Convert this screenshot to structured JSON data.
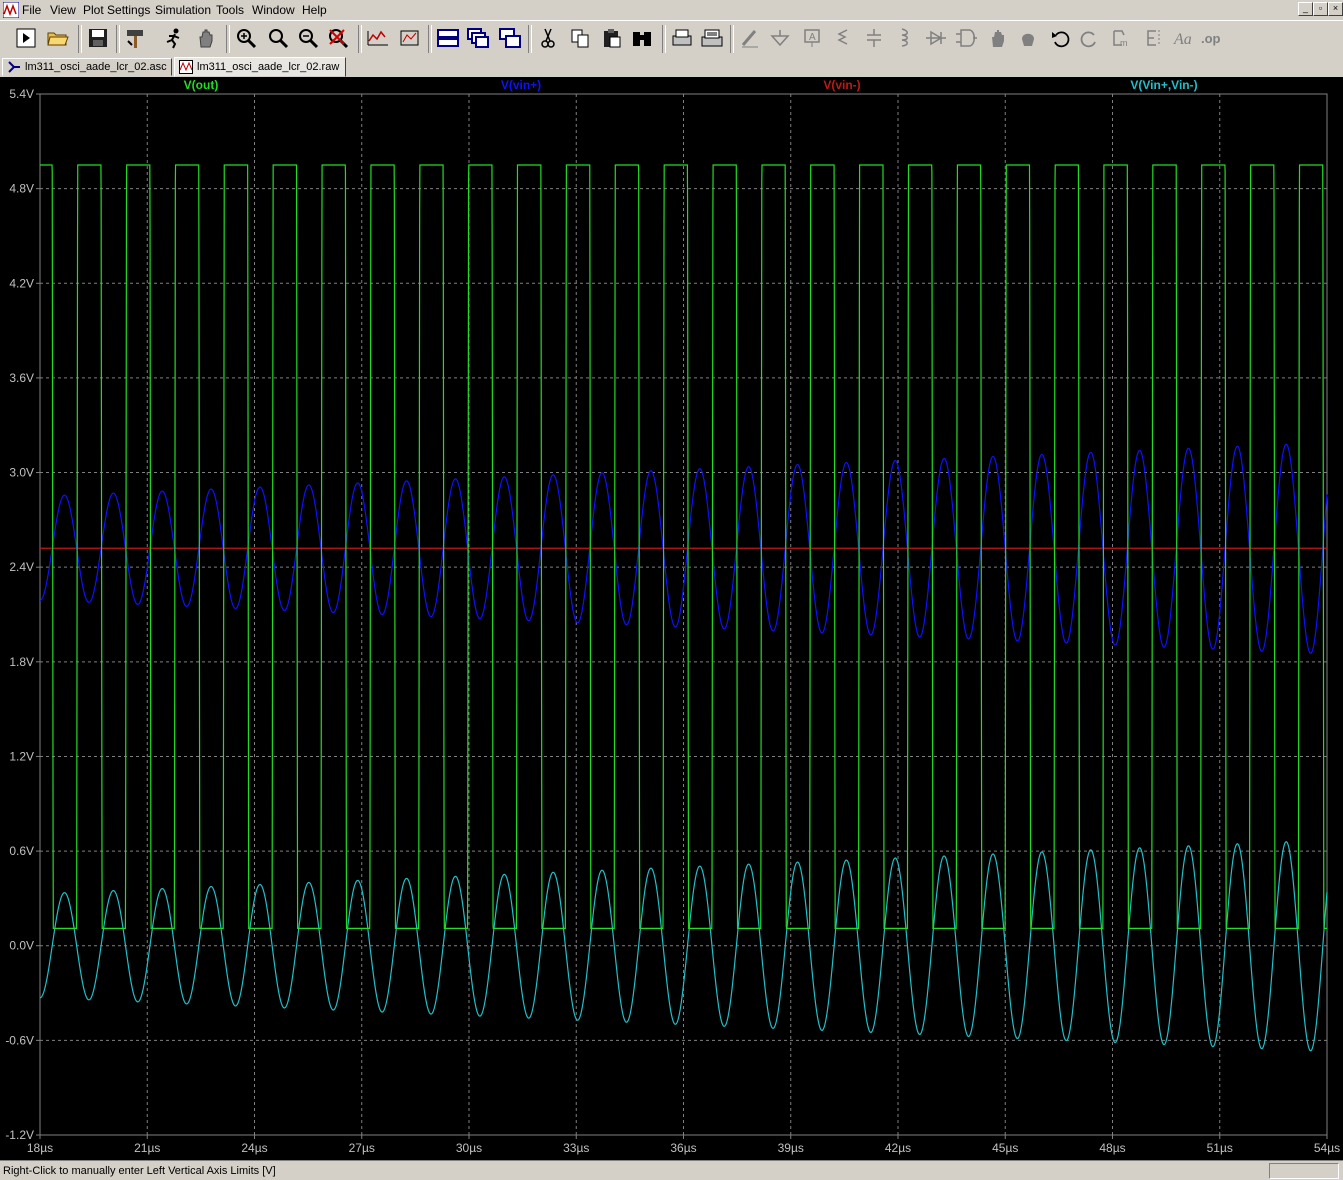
{
  "menu": [
    "File",
    "View",
    "Plot Settings",
    "Simulation",
    "Tools",
    "Window",
    "Help"
  ],
  "tabs": [
    {
      "label": "lm311_osci_aade_lcr_02.asc",
      "icon": "schematic-icon",
      "active": false
    },
    {
      "label": "lm311_osci_aade_lcr_02.raw",
      "icon": "waveform-icon",
      "active": true
    }
  ],
  "status": {
    "text": "Right-Click to manually enter Left Vertical Axis Limits [V]"
  },
  "colors": {
    "plot_bg": "#000000",
    "grid": "#808080",
    "axis_text": "#c0c0c0",
    "out": "#22dd22",
    "vinp": "#1010ff",
    "vinm": "#c01818",
    "diff": "#20c0c8"
  },
  "chart_data": {
    "type": "line",
    "title": "",
    "xlabel": "",
    "ylabel": "",
    "xlim": [
      18,
      54
    ],
    "ylim": [
      -1.2,
      5.4
    ],
    "x_unit": "µs",
    "x_ticks": [
      "18µs",
      "21µs",
      "24µs",
      "27µs",
      "30µs",
      "33µs",
      "36µs",
      "39µs",
      "42µs",
      "45µs",
      "48µs",
      "51µs",
      "54µs"
    ],
    "y_ticks": [
      "5.4V",
      "4.8V",
      "4.2V",
      "3.6V",
      "3.0V",
      "2.4V",
      "1.8V",
      "1.2V",
      "0.6V",
      "0.0V",
      "-0.6V",
      "-1.2V"
    ],
    "grid": true,
    "series": [
      {
        "name": "V(out)",
        "kind": "square",
        "period_us": 1.367,
        "high": 4.95,
        "low": 0.11,
        "duty": 0.5
      },
      {
        "name": "V(vin+)",
        "kind": "sine",
        "period_us": 1.367,
        "offset": 2.52,
        "amp_start": 0.33,
        "amp_end": 0.67
      },
      {
        "name": "V(vin-)",
        "kind": "constant",
        "value": 2.52
      },
      {
        "name": "V(Vin+,Vin-)",
        "kind": "sine",
        "period_us": 1.367,
        "offset": 0.0,
        "amp_start": 0.33,
        "amp_end": 0.67
      }
    ]
  }
}
